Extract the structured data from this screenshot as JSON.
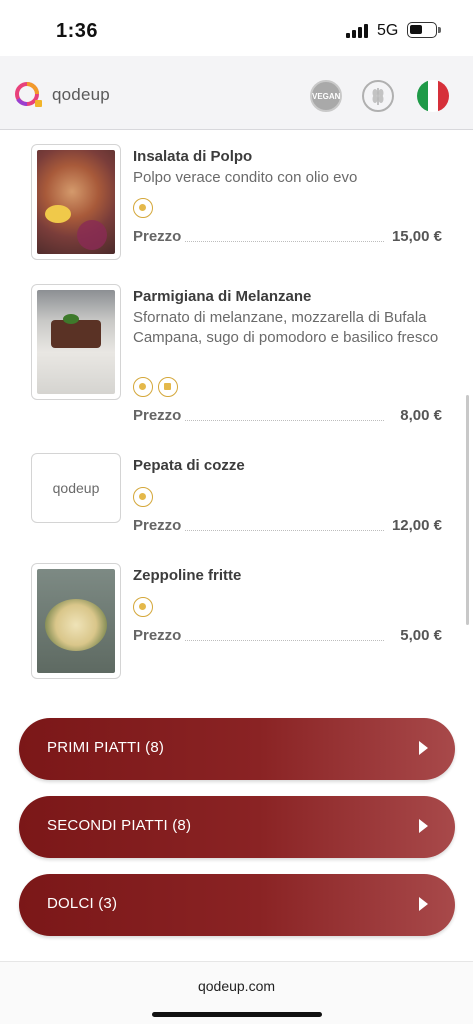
{
  "status_bar": {
    "time": "1:36",
    "network": "5G"
  },
  "header": {
    "logo_text": "qodeup",
    "filters": [
      {
        "icon": "vegan-filter-icon"
      },
      {
        "icon": "gluten-free-filter-icon"
      },
      {
        "icon": "italian-flag-icon"
      }
    ]
  },
  "menu": {
    "items": [
      {
        "name": "Insalata di Polpo",
        "description": "Polpo verace condito con olio evo",
        "allergens": [
          "fish-icon"
        ],
        "price_label": "Prezzo",
        "price": "15,00 €"
      },
      {
        "name": "Parmigiana di Melanzane",
        "description": "Sfornato di melanzane, mozzarella di Bufala Campana, sugo di pomodoro e basilico fresco",
        "allergens": [
          "gluten-icon",
          "milk-icon"
        ],
        "price_label": "Prezzo",
        "price": "8,00 €"
      },
      {
        "name": "Pepata di cozze",
        "description": "",
        "placeholder_logo": "qodeup",
        "allergens": [
          "shellfish-icon"
        ],
        "price_label": "Prezzo",
        "price": "12,00 €"
      },
      {
        "name": "Zeppoline fritte",
        "description": "",
        "allergens": [
          "gluten-icon"
        ],
        "price_label": "Prezzo",
        "price": "5,00 €"
      }
    ]
  },
  "categories": [
    {
      "label": "PRIMI PIATTI  (8)"
    },
    {
      "label": "SECONDI PIATTI  (8)"
    },
    {
      "label": "DOLCI  (3)"
    }
  ],
  "footer": {
    "link": "qodeup.com"
  },
  "colors": {
    "category_red": "#7b1718",
    "allergen_gold": "#d4a73a"
  }
}
